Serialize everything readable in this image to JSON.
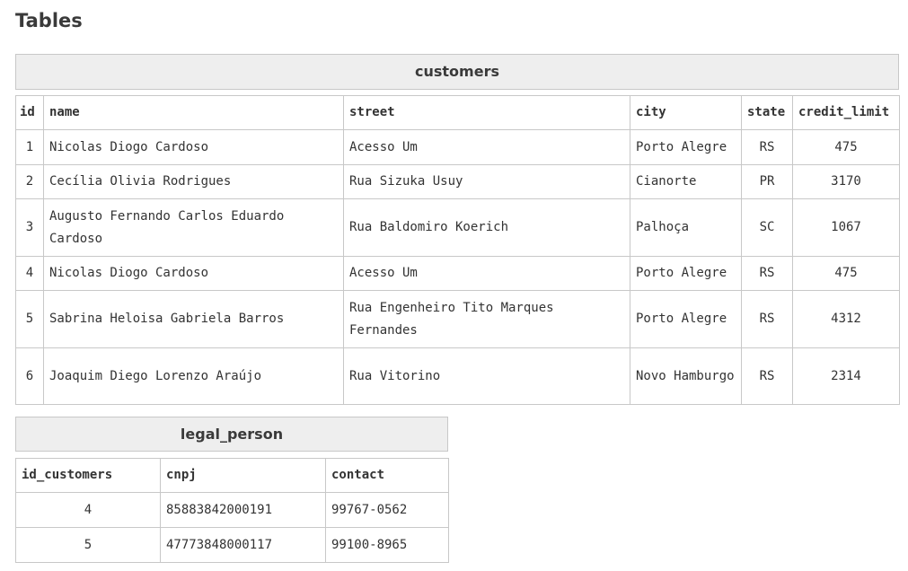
{
  "page": {
    "title": "Tables"
  },
  "customers": {
    "caption": "customers",
    "columns": [
      "id",
      "name",
      "street",
      "city",
      "state",
      "credit_limit"
    ],
    "rows": [
      [
        "1",
        "Nicolas Diogo Cardoso",
        "Acesso Um",
        "Porto Alegre",
        "RS",
        "475"
      ],
      [
        "2",
        "Cecília Olivia Rodrigues",
        "Rua Sizuka Usuy",
        "Cianorte",
        "PR",
        "3170"
      ],
      [
        "3",
        "Augusto Fernando Carlos Eduardo Cardoso",
        "Rua Baldomiro Koerich",
        "Palhoça",
        "SC",
        "1067"
      ],
      [
        "4",
        "Nicolas Diogo Cardoso",
        "Acesso Um",
        "Porto Alegre",
        "RS",
        "475"
      ],
      [
        "5",
        "Sabrina Heloisa Gabriela Barros",
        "Rua Engenheiro Tito Marques Fernandes",
        "Porto Alegre",
        "RS",
        "4312"
      ],
      [
        "6",
        "Joaquim Diego Lorenzo Araújo",
        "Rua Vitorino",
        "Novo Hamburgo",
        "RS",
        "2314"
      ]
    ]
  },
  "legal_person": {
    "caption": "legal_person",
    "columns": [
      "id_customers",
      "cnpj",
      "contact"
    ],
    "rows": [
      [
        "4",
        "85883842000191",
        "99767-0562"
      ],
      [
        "5",
        "47773848000117",
        "99100-8965"
      ]
    ]
  }
}
